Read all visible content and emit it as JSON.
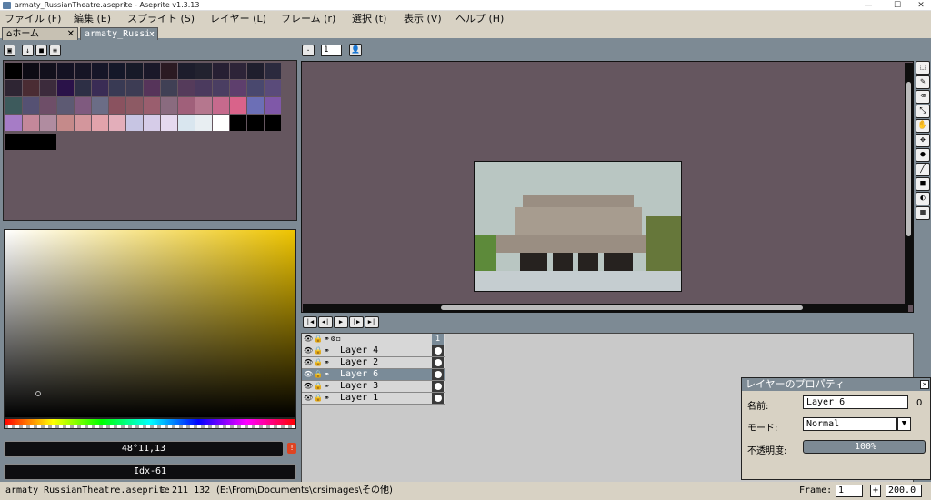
{
  "window": {
    "title": "armaty_RussianTheatre.aseprite - Aseprite v1.3.13",
    "minimize": "—",
    "maximize": "☐",
    "close": "✕"
  },
  "menu": [
    "ファイル (F)",
    "編集 (E)",
    "スプライト (S)",
    "レイヤー (L)",
    "フレーム (r)",
    "選択 (t)",
    "表示 (V)",
    "ヘルプ (H)"
  ],
  "tabs": {
    "home": "ホーム",
    "file": "armaty_Russi:",
    "close": "✕"
  },
  "colors": {
    "accent": "#7d8a94",
    "panel": "#d8d2c4",
    "editor_bg": "#65565f",
    "palette": [
      [
        "#000000",
        "#0d0b14",
        "#12101c",
        "#141223",
        "#161525",
        "#161628",
        "#151829",
        "#171a28",
        "#1a1829",
        "#2b1a22",
        "#1d1d2c",
        "#22222f",
        "#271f33",
        "#2d2438",
        "#1f1e2d",
        "#2b2a3e"
      ],
      [
        "#2e2533",
        "#4a2c33",
        "#3c2b3c",
        "#2a1249",
        "#2d2f45",
        "#3a2c55",
        "#393a54",
        "#3d3c54",
        "#56345a",
        "#404055",
        "#553b5b",
        "#4b3a5e",
        "#4a3e62",
        "#5e3f6d",
        "#49486e",
        "#5a4b7a"
      ],
      [
        "#3d5a5c",
        "#555173",
        "#6e4e68",
        "#5d5a73",
        "#7f5a7f",
        "#6b6d86",
        "#8a525f",
        "#8d5a64",
        "#9a5e6e",
        "#8a6b7f",
        "#a0607a",
        "#b5778e",
        "#c66a8d",
        "#d9638a",
        "#6c6fb6",
        "#7f58a8"
      ],
      [
        "#a67cc6",
        "#c4889a",
        "#b08ca0",
        "#c58a8a",
        "#d3969c",
        "#e2a3ab",
        "#e3aeba",
        "#c7c5e3",
        "#d6cce8",
        "#e5d9ef",
        "#d9e6ef",
        "#e8eef2",
        "#ffffff",
        "#000000",
        "#000000",
        "#000000"
      ]
    ],
    "sprite": {
      "sky": "#b9c6c2",
      "building": "#a79c8f",
      "building_top": "#9a8e82",
      "ground": "#c5cdd0",
      "windows": "#26221f",
      "tree": "#66773a",
      "grass": "#5d8a3a"
    }
  },
  "color_picker": {
    "hsv_text": "48°11,13",
    "index_text": "Idx-61"
  },
  "editor": {
    "zoom": "1",
    "playback": [
      "|◀",
      "◀|",
      "▶",
      "|▶",
      "▶|"
    ]
  },
  "tools": [
    {
      "name": "marquee-tool-icon",
      "glyph": "⬚"
    },
    {
      "name": "pencil-tool-icon",
      "glyph": "✎"
    },
    {
      "name": "eraser-tool-icon",
      "glyph": "⌫"
    },
    {
      "name": "eyedropper-tool-icon",
      "glyph": "⤡"
    },
    {
      "name": "hand-tool-icon",
      "glyph": "✋"
    },
    {
      "name": "move-tool-icon",
      "glyph": "✥"
    },
    {
      "name": "fill-tool-icon",
      "glyph": "●"
    },
    {
      "name": "line-tool-icon",
      "glyph": "╱"
    },
    {
      "name": "rectangle-tool-icon",
      "glyph": "■"
    },
    {
      "name": "contour-tool-icon",
      "glyph": "◐"
    },
    {
      "name": "blur-tool-icon",
      "glyph": "▦"
    }
  ],
  "timeline": {
    "frame_header": "1",
    "layers": [
      {
        "name": "Layer 4",
        "selected": false
      },
      {
        "name": "Layer 2",
        "selected": false
      },
      {
        "name": "Layer 6",
        "selected": true
      },
      {
        "name": "Layer 3",
        "selected": false
      },
      {
        "name": "Layer 1",
        "selected": false
      }
    ]
  },
  "layer_properties": {
    "title": "レイヤーのプロパティ",
    "name_label": "名前:",
    "name_value": "Layer 6",
    "mode_label": "モード:",
    "mode_value": "Normal",
    "opacity_label": "不透明度:",
    "opacity_value": "100%",
    "extra": "0"
  },
  "status": {
    "filename": "armaty_RussianTheatre.aseprite",
    "position": "211 132",
    "path": "(E:\\From\\Documents\\crsimages\\その他)",
    "frame_label": "Frame:",
    "frame_value": "1",
    "plus": "+",
    "zoom_value": "200.0"
  }
}
